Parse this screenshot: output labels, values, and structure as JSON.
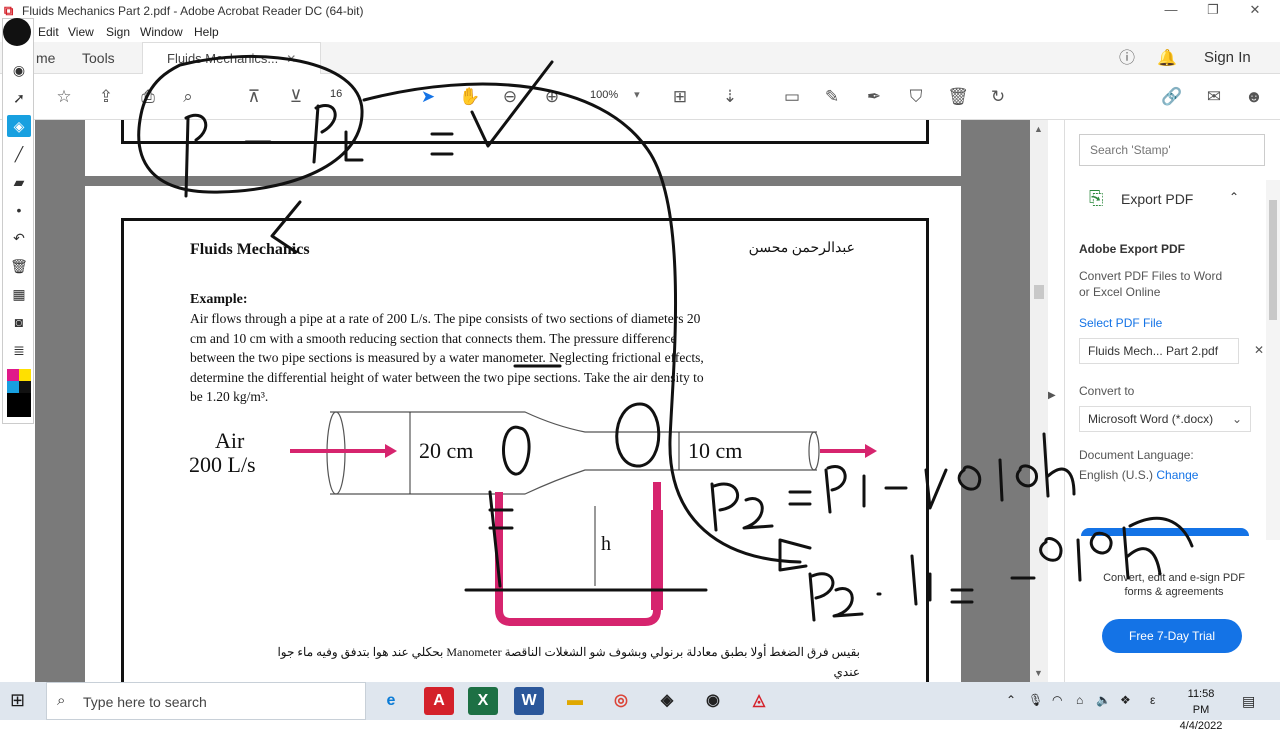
{
  "window": {
    "title": "Fluids Mechanics  Part  2.pdf - Adobe Acrobat Reader DC (64-bit)",
    "app_icon": "acrobat-icon"
  },
  "menu": [
    "Edit",
    "View",
    "Sign",
    "Window",
    "Help"
  ],
  "tabs": {
    "home": "me",
    "tools": "Tools",
    "document": "Fluids Mechanics..."
  },
  "header": {
    "sign_in": "Sign In"
  },
  "toolbar": {
    "page_number": "16",
    "zoom": "100%"
  },
  "document": {
    "heading_left": "Fluids Mechanics",
    "heading_right": "عبدالرحمن محسن",
    "example_label": "Example:",
    "body_lines": [
      "Air flows through a pipe at a rate of 200 L/s. The pipe consists of two sections of diameters 20",
      "cm and 10 cm with a smooth reducing section that connects them. The pressure difference",
      "between the two pipe sections is measured by a water manometer. Neglecting frictional effects,",
      "determine the differential height of water between the two pipe sections. Take the air density to",
      "be 1.20 kg/m³."
    ],
    "figure": {
      "air_label_1": "Air",
      "air_label_2": "200 L/s",
      "d1_label": "20 cm",
      "d2_label": "10 cm",
      "h_label": "h"
    },
    "arabic_note_1": "بحكلي عند هوا بتدفق وفيه ماء جوا Manometer بقيس فرق الضغط أولا بطبق معادلة برنولي وبشوف شو الشغلات الناقصة",
    "arabic_note_2": "عندي"
  },
  "right_pane": {
    "search_placeholder": "Search 'Stamp'",
    "export_title": "Export PDF",
    "adobe_export_title": "Adobe Export PDF",
    "adobe_export_desc_1": "Convert PDF Files to Word",
    "adobe_export_desc_2": "or Excel Online",
    "select_file_label": "Select PDF File",
    "selected_file": "Fluids Mech... Part 2.pdf",
    "convert_to_label": "Convert to",
    "convert_to_value": "Microsoft Word (*.docx)",
    "doc_language_label": "Document Language:",
    "doc_language_value": "English (U.S.)",
    "change_link": "Change",
    "promo_line_1": "Convert, edit and e-sign PDF",
    "promo_line_2": "forms & agreements",
    "trial_button": "Free 7-Day Trial"
  },
  "taskbar": {
    "search_placeholder": "Type here to search",
    "time": "11:58 PM",
    "date": "4/4/2022",
    "lang": "ε"
  },
  "colors": {
    "accent": "#1473e6",
    "ink": "#111111",
    "manometer": "#d6246e"
  }
}
